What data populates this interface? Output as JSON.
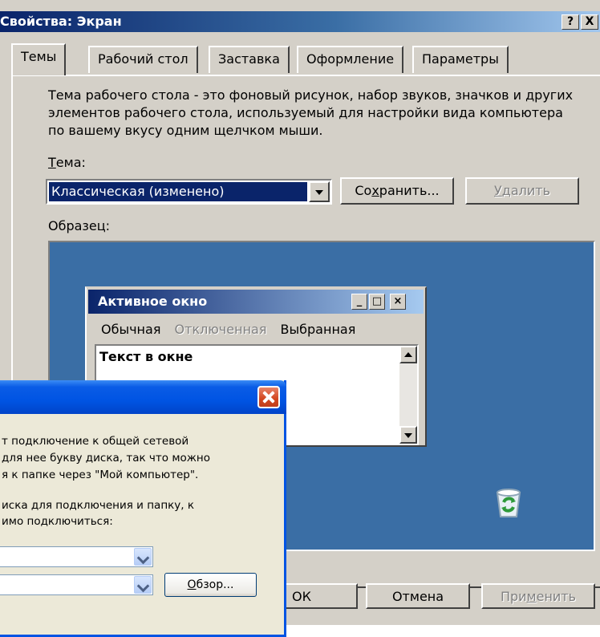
{
  "dialog": {
    "title": "Свойства: Экран",
    "help_button": "?",
    "close_button": "X",
    "tabs": [
      {
        "label": "Темы"
      },
      {
        "label": "Рабочий стол"
      },
      {
        "label": "Заставка"
      },
      {
        "label": "Оформление"
      },
      {
        "label": "Параметры"
      }
    ],
    "description": "Тема рабочего стола - это фоновый рисунок, набор звуков, значков и других элементов рабочего стола, используемый для настройки вида компьютера по вашему вкусу одним щелчком мыши.",
    "theme_label_first": "Т",
    "theme_label_rest": "ема:",
    "theme_value": "Классическая (изменено)",
    "save_pre": "Со",
    "save_ul": "х",
    "save_post": "ранить...",
    "delete_ul": "У",
    "delete_post": "далить",
    "sample_label": "Образец:",
    "ok_label": "ОК",
    "cancel_label": "Отмена",
    "apply_pre": "При",
    "apply_ul": "м",
    "apply_post": "енить"
  },
  "preview": {
    "window_title": "Активное окно",
    "menu_normal": "Обычная",
    "menu_disabled": "Отключенная",
    "menu_selected": "Выбранная",
    "window_text": "Текст в окне",
    "min_glyph": "_",
    "max_glyph": "□",
    "close_glyph": "×"
  },
  "map_drive": {
    "line1": "т подключение к общей сетевой",
    "line2": " для нее букву диска, так что можно",
    "line3": "я к папке через \"Мой компьютер\".",
    "line4": "иска для подключения и папку, к",
    "line5": "имо подключиться:",
    "browse_ul": "О",
    "browse_post": "бзор..."
  },
  "colors": {
    "classic_face": "#d4d0c8",
    "classic_title": "#0a246a",
    "desktop_blue": "#3a6ea5",
    "xp_title_blue": "#0054e3",
    "xp_close_red": "#d2461e"
  }
}
